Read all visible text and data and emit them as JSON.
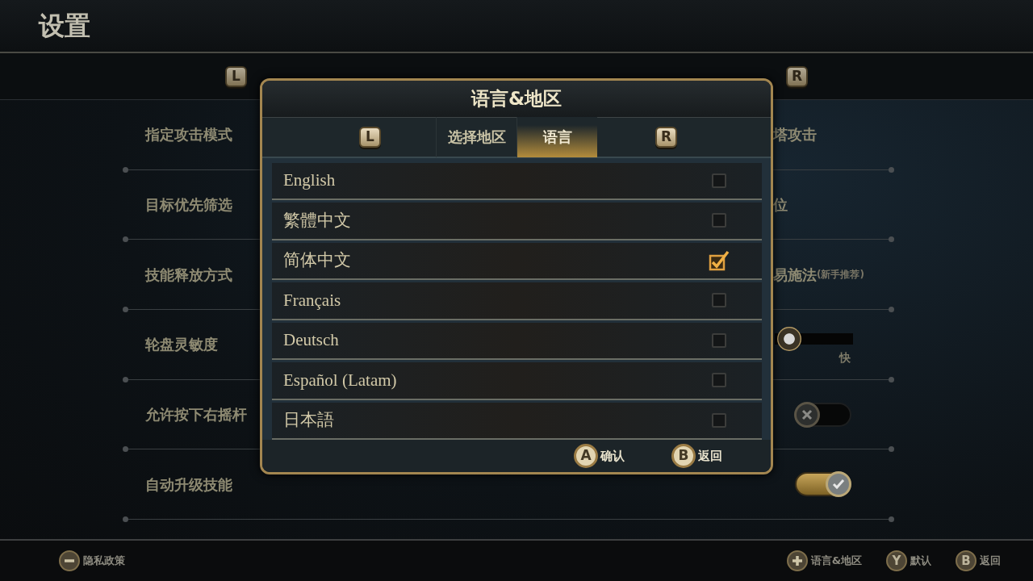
{
  "header": {
    "title": "设置"
  },
  "tabs": {
    "prev_key": "L",
    "next_key": "R"
  },
  "settings": [
    {
      "label": "指定攻击模式",
      "kind": "text",
      "value": "塔攻击"
    },
    {
      "label": "目标优先筛选",
      "kind": "text",
      "value": "位"
    },
    {
      "label": "技能释放方式",
      "kind": "text",
      "value": "易施法",
      "note": "(新手推荐)"
    },
    {
      "label": "轮盘灵敏度",
      "kind": "slider",
      "level": 0.05,
      "max_label": "快"
    },
    {
      "label": "允许按下右摇杆",
      "kind": "toggle",
      "on": false
    },
    {
      "label": "自动升级技能",
      "kind": "toggle",
      "on": true
    }
  ],
  "dialog": {
    "title": "语言&地区",
    "prev_key": "L",
    "next_key": "R",
    "tabs": [
      {
        "label": "选择地区",
        "selected": false
      },
      {
        "label": "语言",
        "selected": true
      }
    ],
    "languages": [
      {
        "name": "English",
        "checked": false
      },
      {
        "name": "繁體中文",
        "checked": false
      },
      {
        "name": "简体中文",
        "checked": true
      },
      {
        "name": "Français",
        "checked": false
      },
      {
        "name": "Deutsch",
        "checked": false
      },
      {
        "name": "Español (Latam)",
        "checked": false
      },
      {
        "name": "日本語",
        "checked": false
      }
    ],
    "actions": [
      {
        "key": "A",
        "label": "确认"
      },
      {
        "key": "B",
        "label": "返回"
      }
    ]
  },
  "footer": {
    "left": [
      {
        "kind": "minus",
        "label": "隐私政策"
      }
    ],
    "right": [
      {
        "kind": "plus",
        "label": "语言&地区"
      },
      {
        "kind": "key",
        "key": "Y",
        "label": "默认"
      },
      {
        "kind": "key",
        "key": "B",
        "label": "返回"
      }
    ]
  }
}
